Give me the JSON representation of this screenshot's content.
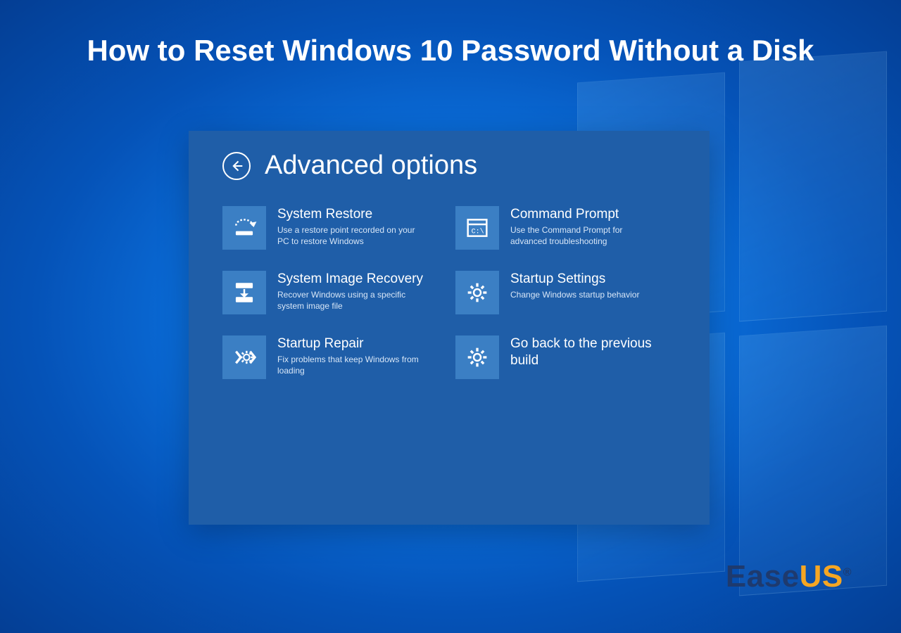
{
  "headline": "How to Reset Windows 10 Password Without a Disk",
  "panel": {
    "title": "Advanced options",
    "options": [
      {
        "title": "System Restore",
        "desc": "Use a restore point recorded on your PC to restore Windows"
      },
      {
        "title": "Command Prompt",
        "desc": "Use the Command Prompt for advanced troubleshooting"
      },
      {
        "title": "System Image Recovery",
        "desc": "Recover Windows using a specific system image file"
      },
      {
        "title": "Startup Settings",
        "desc": "Change Windows startup behavior"
      },
      {
        "title": "Startup Repair",
        "desc": "Fix problems that keep Windows from loading"
      },
      {
        "title": "Go back to the previous build",
        "desc": ""
      }
    ]
  },
  "brand": {
    "ease": "Ease",
    "us": "US",
    "reg": "®"
  }
}
